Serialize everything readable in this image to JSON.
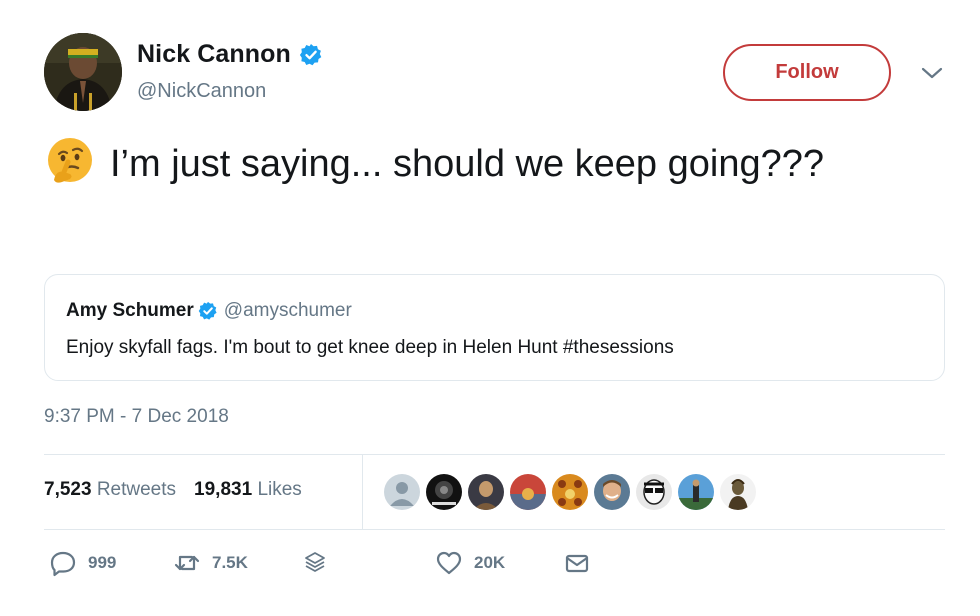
{
  "author": {
    "display_name": "Nick Cannon",
    "handle": "@NickCannon",
    "verified": true
  },
  "follow_button": {
    "label": "Follow",
    "color": "#c33b3b"
  },
  "tweet": {
    "emoji": "thinking-face",
    "text": "I’m just saying... should we keep going???"
  },
  "quoted_tweet": {
    "display_name": "Amy Schumer",
    "handle": "@amyschumer",
    "verified": true,
    "text": "Enjoy skyfall fags. I'm bout to get knee deep in Helen Hunt #thesessions"
  },
  "timestamp": "9:37 PM - 7 Dec 2018",
  "stats": {
    "retweets_count": "7,523",
    "retweets_label": "Retweets",
    "likes_count": "19,831",
    "likes_label": "Likes"
  },
  "liker_avatars": [
    "default-avatar",
    "album-avatar",
    "portrait-avatar",
    "sunset-avatar",
    "pattern-avatar",
    "smiling-man-avatar",
    "sunglasses-avatar",
    "outdoor-avatar",
    "statue-avatar"
  ],
  "actions": {
    "reply_count": "999",
    "retweet_count": "7.5K",
    "like_count": "20K"
  },
  "icons": [
    "verified-badge-icon",
    "chevron-down-icon",
    "reply-icon",
    "retweet-icon",
    "stack-icon",
    "heart-icon",
    "mail-icon"
  ],
  "colors": {
    "verified_blue": "#1da1f2",
    "secondary_text": "#657786",
    "primary_text": "#14171a",
    "border": "#e1e8ed"
  }
}
